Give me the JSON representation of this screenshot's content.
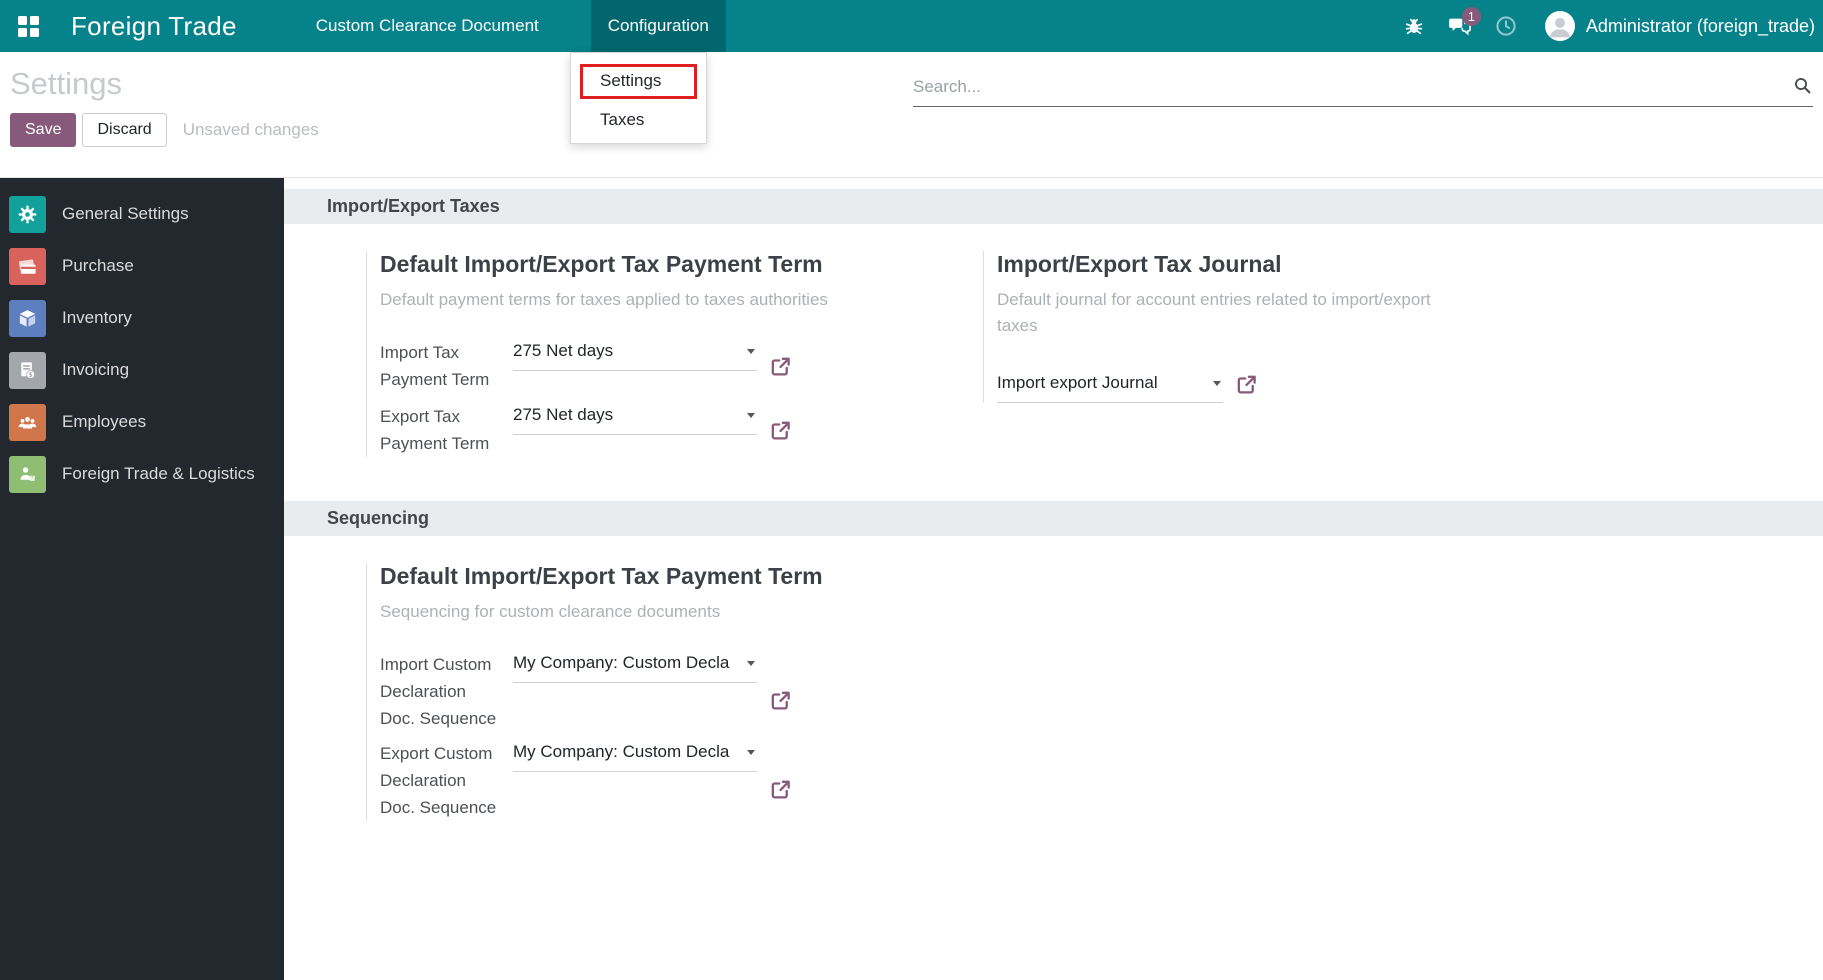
{
  "navbar": {
    "app_name": "Foreign Trade",
    "menu_custom_clearance": "Custom Clearance Document",
    "menu_configuration": "Configuration",
    "chat_badge": "1",
    "user_name": "Administrator (foreign_trade)"
  },
  "config_dropdown": {
    "settings_label": "Settings",
    "taxes_label": "Taxes",
    "highlight_color": "#E02020"
  },
  "control_panel": {
    "title": "Settings",
    "save_label": "Save",
    "discard_label": "Discard",
    "status_text": "Unsaved changes",
    "search_placeholder": "Search..."
  },
  "sidebar": {
    "items": [
      {
        "label": "General Settings",
        "icon": "gear-icon",
        "color": "#12A09B"
      },
      {
        "label": "Purchase",
        "icon": "credit-card-icon",
        "color": "#D9635C"
      },
      {
        "label": "Inventory",
        "icon": "box-icon",
        "color": "#5D7FC0"
      },
      {
        "label": "Invoicing",
        "icon": "invoice-icon",
        "color": "#A3A6AA"
      },
      {
        "label": "Employees",
        "icon": "people-icon",
        "color": "#D0764B"
      },
      {
        "label": "Foreign Trade & Logistics",
        "icon": "logistics-icon",
        "color": "#8FBE73"
      }
    ]
  },
  "content": {
    "section1": {
      "title": "Import/Export Taxes",
      "left": {
        "heading": "Default Import/Export Tax Payment Term",
        "description": "Default payment terms for taxes applied to taxes authorities",
        "field1": {
          "label": "Import Tax Payment Term",
          "value": "275 Net days"
        },
        "field2": {
          "label": "Export Tax Payment Term",
          "value": "275 Net days"
        }
      },
      "right": {
        "heading": "Import/Export Tax Journal",
        "description": "Default journal for account entries related to import/export taxes",
        "field1": {
          "value": "Import export Journal"
        }
      }
    },
    "section2": {
      "title": "Sequencing",
      "left": {
        "heading": "Default Import/Export Tax Payment Term",
        "description": "Sequencing for custom clearance documents",
        "field1": {
          "label": "Import Custom Declaration Doc. Sequence",
          "value": "My Company: Custom Decla"
        },
        "field2": {
          "label": "Export Custom Declaration Doc. Sequence",
          "value": "My Company: Custom Decla"
        }
      }
    }
  },
  "colors": {
    "navbar_teal": "#06828A",
    "primary_purple": "#875A7B",
    "annotation_red": "#E02020",
    "section_band_gray": "#e9ecef",
    "sidebar_dark": "#23272E"
  }
}
